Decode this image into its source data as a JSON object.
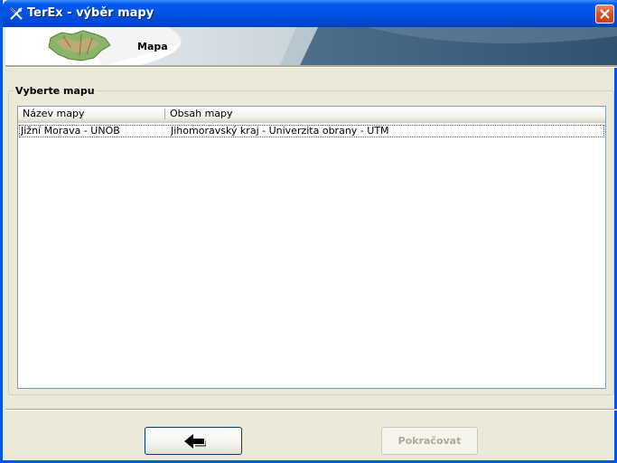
{
  "window": {
    "title": "TerEx - výběr mapy",
    "titlebar_color": "#0054e3"
  },
  "banner": {
    "title": "Mapa",
    "accent_color": "#3a5f7d"
  },
  "map_group": {
    "label": "Vyberte mapu",
    "columns": [
      "Název mapy",
      "Obsah mapy"
    ],
    "rows": [
      {
        "name": "Jižní Morava - UNOB",
        "content": "Jihomoravský kraj - Univerzita obrany - UTM"
      }
    ]
  },
  "buttons": {
    "back_icon": "arrow-left-icon",
    "continue_label": "Pokračovat"
  }
}
